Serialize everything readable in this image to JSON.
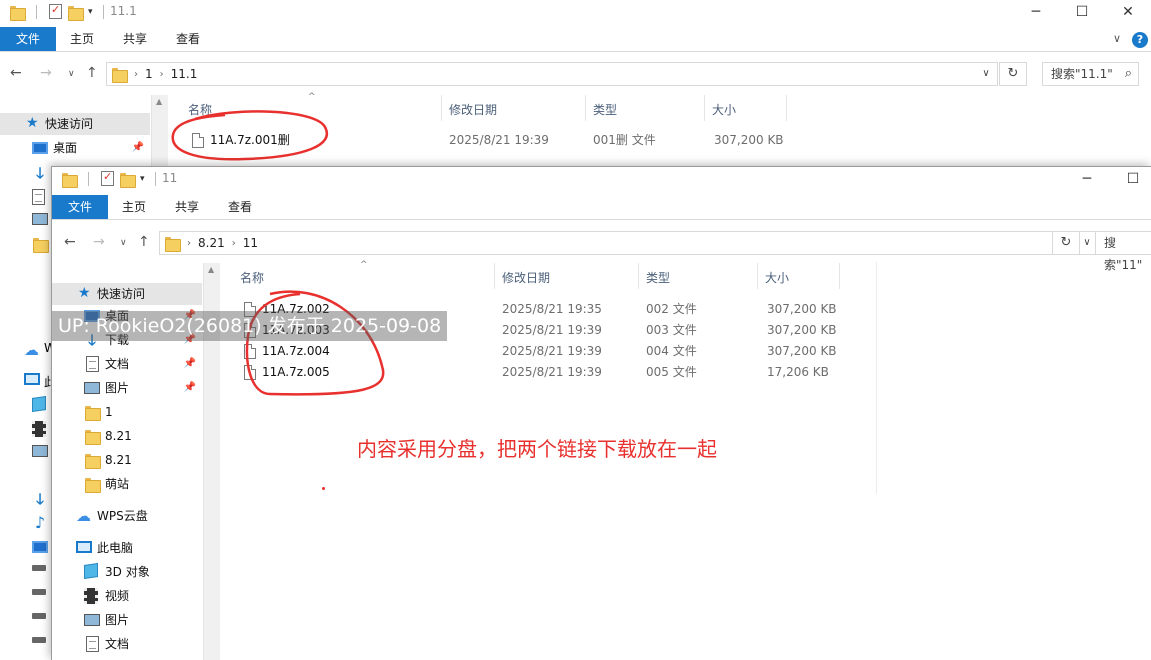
{
  "back_window": {
    "title": "11.1",
    "ribbon_tabs": [
      "文件",
      "主页",
      "共享",
      "查看"
    ],
    "breadcrumb": [
      "1",
      "11.1"
    ],
    "search_placeholder": "搜索\"11.1\"",
    "columns": [
      "名称",
      "修改日期",
      "类型",
      "大小"
    ],
    "files": [
      {
        "name": "11A.7z.001删",
        "modified": "2025/8/21 19:39",
        "type": "001删 文件",
        "size": "307,200 KB"
      }
    ],
    "nav": {
      "quick_access": "快速访问",
      "desktop": "桌面"
    }
  },
  "front_window": {
    "title": "11",
    "ribbon_tabs": [
      "文件",
      "主页",
      "共享",
      "查看"
    ],
    "breadcrumb": [
      "8.21",
      "11"
    ],
    "search_placeholder": "搜索\"11\"",
    "columns": [
      "名称",
      "修改日期",
      "类型",
      "大小"
    ],
    "files": [
      {
        "name": "11A.7z.002",
        "modified": "2025/8/21 19:35",
        "type": "002 文件",
        "size": "307,200 KB"
      },
      {
        "name": "11A.7z.003",
        "modified": "2025/8/21 19:39",
        "type": "003 文件",
        "size": "307,200 KB"
      },
      {
        "name": "11A.7z.004",
        "modified": "2025/8/21 19:39",
        "type": "004 文件",
        "size": "307,200 KB"
      },
      {
        "name": "11A.7z.005",
        "modified": "2025/8/21 19:39",
        "type": "005 文件",
        "size": "17,206 KB"
      }
    ],
    "nav": {
      "quick_access": "快速访问",
      "desktop": "桌面",
      "downloads": "下载",
      "documents": "文档",
      "pictures": "图片",
      "folder_1": "1",
      "folder_821a": "8.21",
      "folder_821b": "8.21",
      "folder_mengzhan": "萌站",
      "wps_cloud": "WPS云盘",
      "this_pc": "此电脑",
      "objects_3d": "3D 对象",
      "videos": "视频",
      "pictures_pc": "图片",
      "documents_pc": "文档"
    }
  },
  "back_nav_partial": {
    "w_label": "W",
    "pc_label": "此"
  },
  "watermark": "UP: RookieO2(26081) 发布于 2025-09-08",
  "annotation": "内容采用分盘，把两个链接下载放在一起",
  "colors": {
    "accent": "#1979ca",
    "annotation_red": "#e8312e",
    "folder_yellow": "#f5cf5f"
  }
}
